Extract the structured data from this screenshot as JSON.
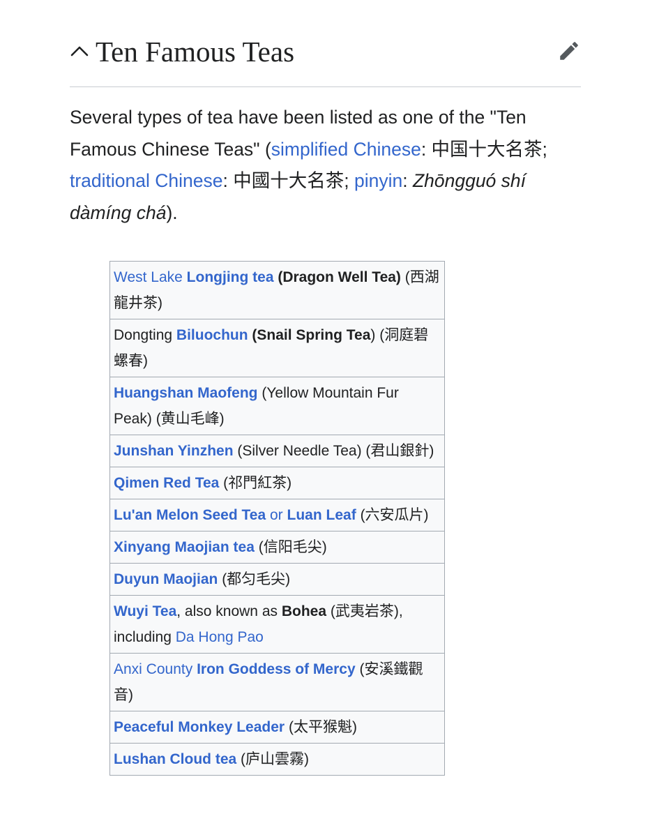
{
  "section": {
    "title": "Ten Famous Teas",
    "collapse_icon": "chevron-up-icon",
    "edit_icon": "pencil-icon"
  },
  "intro": {
    "t1": "Several types of tea have been listed as one of the \"Ten Famous Chinese Teas\" (",
    "simplified_link": "simplified Chinese",
    "t2": ": 中国十大名茶; ",
    "traditional_link": "traditional Chinese",
    "t3": ": 中國十大名茶; ",
    "pinyin_link": "pinyin",
    "t4": ": ",
    "pinyin_text": "Zhōngguó shí dàmíng chá",
    "t5": ")."
  },
  "teas": [
    {
      "a": "West Lake",
      "b": "Longjing tea",
      "c": "(Dragon Well Tea)",
      "d": "(西湖龍井茶)"
    },
    {
      "a": "Dongting",
      "b": "Biluochun",
      "c": "(Snail Spring Tea",
      "d": ") (洞庭碧螺春)"
    },
    {
      "a": "Huangshan Maofeng",
      "b": "(Yellow Mountain Fur Peak) (黄山毛峰)"
    },
    {
      "a": "Junshan Yinzhen",
      "b": "(Silver Needle Tea) (君山銀針)"
    },
    {
      "a": "Qimen Red Tea",
      "b": "(祁門紅茶)"
    },
    {
      "a": "Lu'an Melon Seed Tea",
      "b": "or",
      "c": "Luan Leaf",
      "d": "(六安瓜片)"
    },
    {
      "a": "Xinyang Maojian tea",
      "b": "(信阳毛尖)"
    },
    {
      "a": "Duyun Maojian",
      "b": "(都匀毛尖)"
    },
    {
      "a": "Wuyi Tea",
      "b": ", also known as",
      "c": "Bohea",
      "d": "(武夷岩茶), including",
      "e": "Da Hong Pao"
    },
    {
      "a": "Anxi County",
      "b": "Iron Goddess of Mercy",
      "c": "(安溪鐵觀音)"
    },
    {
      "a": "Peaceful Monkey Leader",
      "b": "(太平猴魁)"
    },
    {
      "a": "Lushan Cloud tea",
      "b": "(庐山雲霧)"
    }
  ]
}
